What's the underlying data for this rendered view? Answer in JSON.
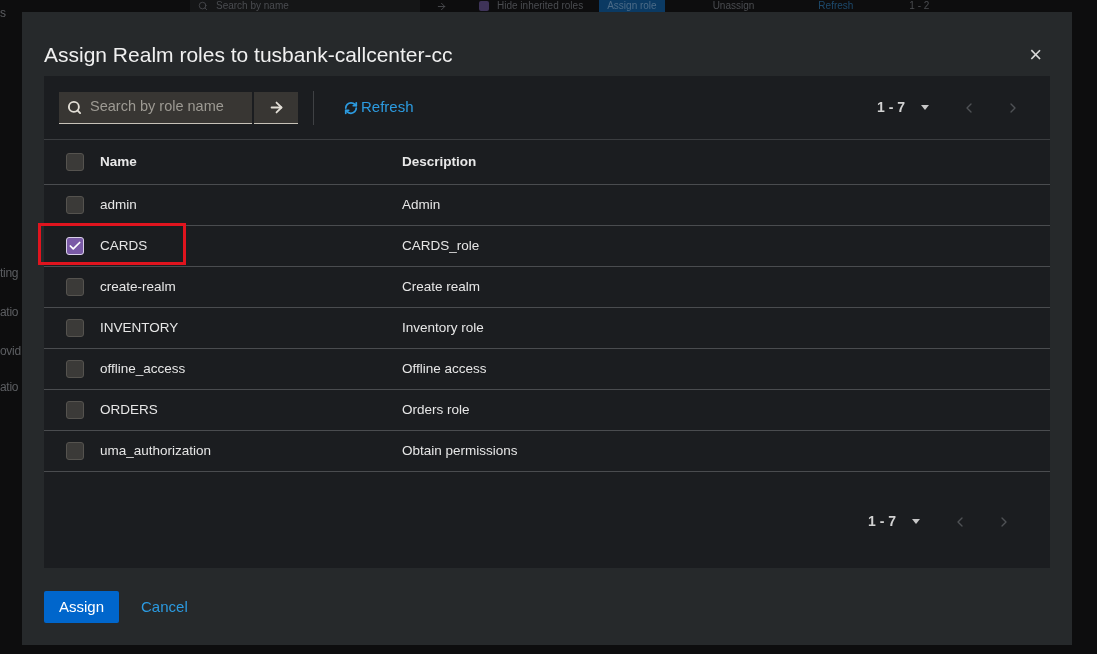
{
  "background": {
    "toolbar": {
      "search_placeholder": "Search by name",
      "hide_inherited": {
        "label": "Hide inherited roles",
        "checked": true
      },
      "assign_button": "Assign role",
      "unassign_button": "Unassign",
      "refresh": "Refresh",
      "pagination": "1 - 2"
    },
    "sidebar_fragments": [
      "s",
      "ting",
      "atio",
      "ovid",
      "atio"
    ]
  },
  "dialog": {
    "title": "Assign Realm roles to tusbank-callcenter-cc",
    "close": "×",
    "toolbar": {
      "search_placeholder": "Search by role name",
      "refresh": "Refresh",
      "pagination": "1 - 7"
    },
    "table": {
      "columns": [
        "Name",
        "Description"
      ],
      "all_checked": false,
      "rows": [
        {
          "name": "admin",
          "description": "Admin",
          "checked": false,
          "highlighted": false
        },
        {
          "name": "CARDS",
          "description": "CARDS_role",
          "checked": true,
          "highlighted": true
        },
        {
          "name": "create-realm",
          "description": "Create realm",
          "checked": false,
          "highlighted": false
        },
        {
          "name": "INVENTORY",
          "description": "Inventory role",
          "checked": false,
          "highlighted": false
        },
        {
          "name": "offline_access",
          "description": "Offline access",
          "checked": false,
          "highlighted": false
        },
        {
          "name": "ORDERS",
          "description": "Orders role",
          "checked": false,
          "highlighted": false
        },
        {
          "name": "uma_authorization",
          "description": "Obtain permissions",
          "checked": false,
          "highlighted": false
        }
      ]
    },
    "bottom_pagination": "1 - 7",
    "buttons": {
      "assign": "Assign",
      "cancel": "Cancel"
    }
  }
}
